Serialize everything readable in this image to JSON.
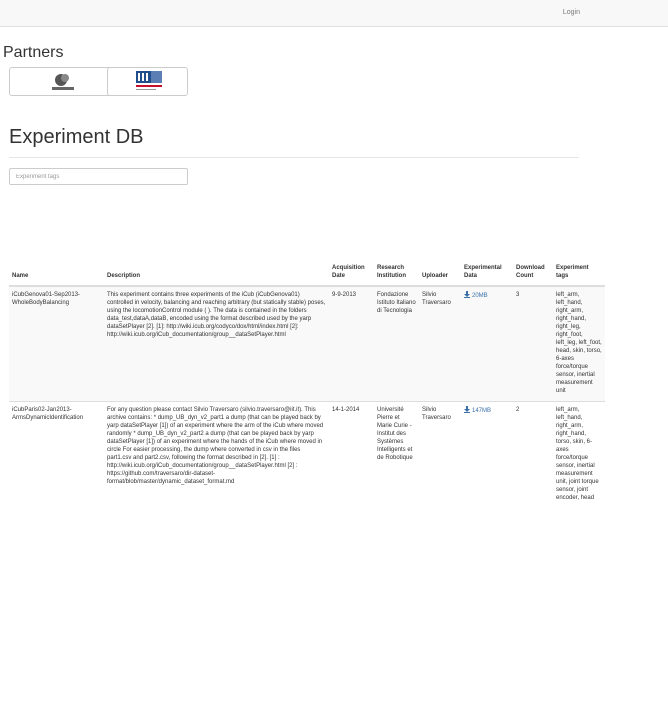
{
  "navbar": {
    "login_label": "Login"
  },
  "partners": {
    "title": "Partners",
    "items": [
      {
        "name": "Ceerob",
        "logo_text": "ceerob"
      },
      {
        "name": "IIT",
        "logo_text": "iit"
      }
    ]
  },
  "page": {
    "title": "Experiment DB"
  },
  "search": {
    "placeholder": "Experiment tags",
    "value": ""
  },
  "table": {
    "headers": {
      "name": "Name",
      "description": "Description",
      "acquisition_date": "Acquisition Date",
      "research_institution": "Research Institution",
      "uploader": "Uploader",
      "experimental_data": "Experimental Data",
      "download_count": "Download Count",
      "experiment_tags": "Experiment tags"
    },
    "rows": [
      {
        "name": "iCubGenova01-Sep2013-WholeBodyBalancing",
        "description": "This experiment contains three experiments of the iCub (iCubGenova01) controlled in velocity, balancing and reaching arbitrary (but statically stable) poses, using the locomotionControl module ( ). The data is contained in the folders data_test,dataA,dataB, encoded using the format described used by the yarp dataSetPlayer [2]. [1]: http://wiki.icub.org/codyco/dox/html/index.html [2]: http://wiki.icub.org/iCub_documentation/group__dataSetPlayer.html",
        "acquisition_date": "9-9-2013",
        "research_institution": "Fondazione Istituto Italiano di Tecnologia",
        "uploader": "Silvio Traversaro",
        "experimental_data": "20MB",
        "download_count": "3",
        "experiment_tags": "left_arm, left_hand, right_arm, right_hand, right_leg, right_foot, left_leg, left_foot, head, skin, torso, 6-axes force/torque sensor, inertial measurement unit"
      },
      {
        "name": "iCubParis02-Jan2013-ArmsDynamicIdentification",
        "description": "For any question please contact Silvio Traversaro (silvio.traversaro@iit.it). This archive contains: * dump_UB_dyn_v2_part1 a dump (that can be played back by yarp dataSetPlayer [1]) of an experiment where the arm of the iCub where moved randomly * dump_UB_dyn_v2_part2 a dump (that can be played back by yarp dataSetPlayer [1]) of an experiment where the hands of the iCub where moved in circle For easier processing, the dump where converted in csv in the files part1.csv and part2.csv, following the format described in [2]. [1] : http://wiki.icub.org/iCub_documentation/group__dataSetPlayer.html [2] : https://github.com/traversaro/dir-dataset-format/blob/master/dynamic_dataset_format.md",
        "acquisition_date": "14-1-2014",
        "research_institution": "Université Pierre et Marie Curie - Institut des Systèmes Intelligents et de Robotique",
        "uploader": "Silvio Traversaro",
        "experimental_data": "147MB",
        "download_count": "2",
        "experiment_tags": "left_arm, left_hand, right_arm, right_hand, torso, skin, 6-axes force/torque sensor, inertial measurement unit, joint torque sensor, joint encoder, head"
      }
    ]
  },
  "colors": {
    "link": "#3a6fa8",
    "navbar_bg": "#f8f8f8",
    "iit_red": "#c8102e",
    "iit_blue": "#1f4e8c"
  },
  "icons": {
    "download": "download-icon"
  }
}
